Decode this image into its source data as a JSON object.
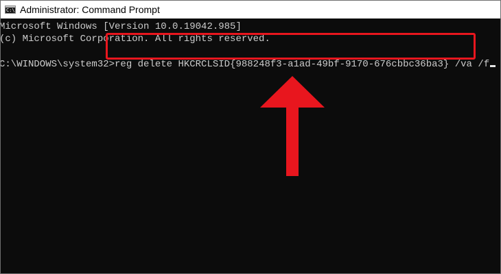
{
  "window": {
    "title": "Administrator: Command Prompt",
    "icon": "cmd-icon",
    "icon_glyph": "C:\\"
  },
  "console": {
    "line1": "Microsoft Windows [Version 10.0.19042.985]",
    "line2": "(c) Microsoft Corporation. All rights reserved.",
    "prompt": "C:\\WINDOWS\\system32>",
    "command": "reg delete HKCRCLSID{988248f3-a1ad-49bf-9170-676cbbc36ba3} /va /f"
  },
  "annotation": {
    "highlight_color": "#e8161e",
    "arrow_color": "#e8161e",
    "arrow_icon": "up-arrow-icon"
  }
}
